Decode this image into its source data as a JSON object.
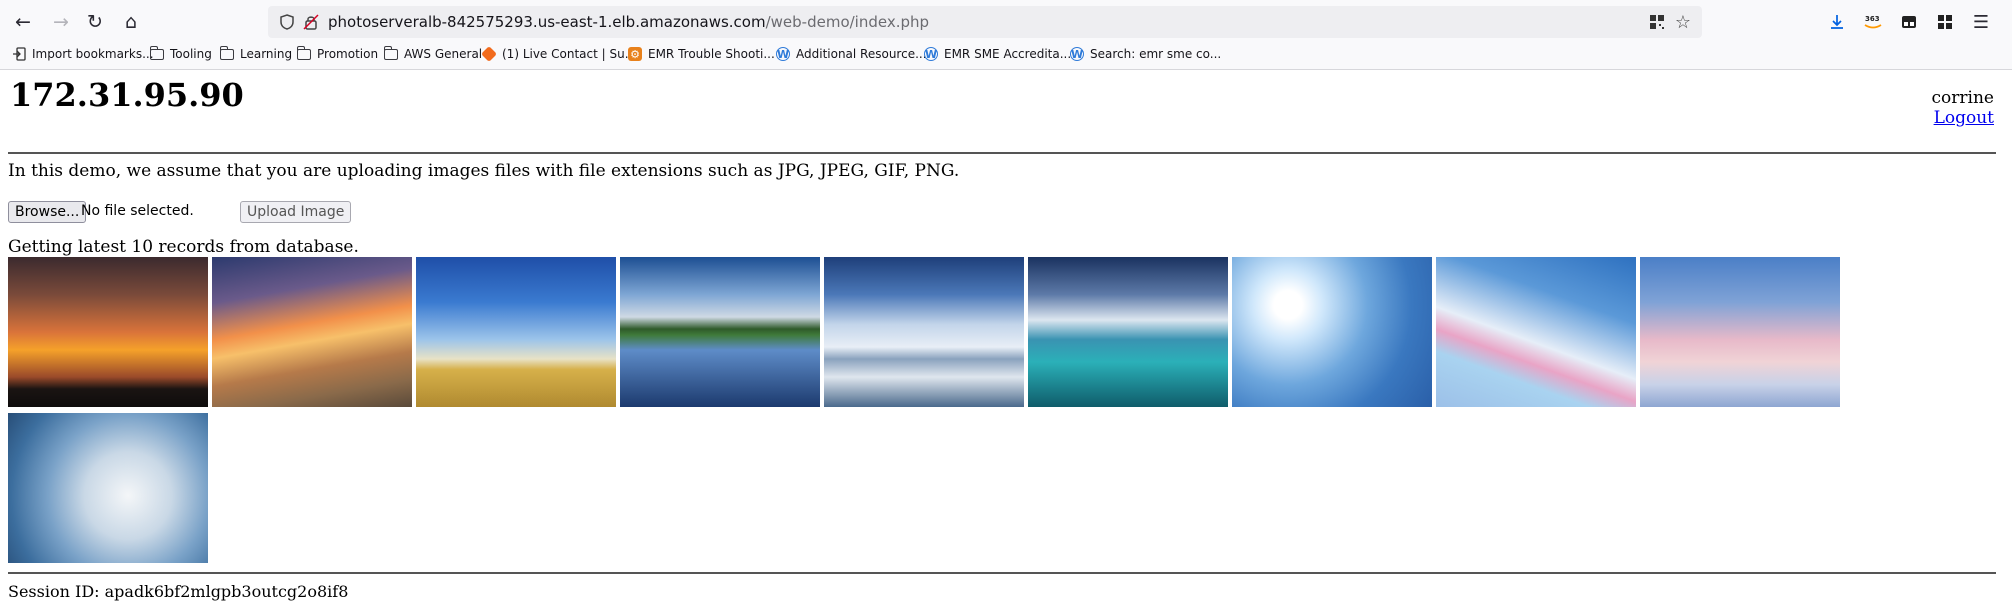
{
  "browser": {
    "url_host": "photoserveralb-842575293.us-east-1.elb.amazonaws.com",
    "url_path": "/web-demo/index.php",
    "icons": [
      "back-icon",
      "forward-icon",
      "reload-icon",
      "home-icon",
      "shield-icon",
      "insecure-lock-icon",
      "qr-code-icon",
      "star-icon",
      "download-icon",
      "amazon-extension-icon",
      "container-icon",
      "extensions-icon",
      "menu-icon"
    ]
  },
  "bookmarks": [
    {
      "label": "Import bookmarks...",
      "icon": "import-icon"
    },
    {
      "label": "Tooling",
      "icon": "folder-icon"
    },
    {
      "label": "Learning",
      "icon": "folder-icon"
    },
    {
      "label": "Promotion",
      "icon": "folder-icon"
    },
    {
      "label": "AWS General",
      "icon": "folder-icon"
    },
    {
      "label": "(1) Live Contact | Su...",
      "icon": "orange-cube-icon"
    },
    {
      "label": "EMR Trouble Shooti...",
      "icon": "emr-icon"
    },
    {
      "label": "Additional Resource...",
      "icon": "wiki-icon"
    },
    {
      "label": "EMR SME Accredita...",
      "icon": "wiki-icon"
    },
    {
      "label": "Search: emr sme co...",
      "icon": "wiki-icon"
    }
  ],
  "page": {
    "host_ip": "172.31.95.90",
    "username": "corrine",
    "logout_label": "Logout",
    "intro": "In this demo, we assume that you are uploading images files with file extensions such as JPG, JPEG, GIF, PNG.",
    "browse_label": "Browse...",
    "no_file_label": "No file selected.",
    "upload_label": "Upload Image",
    "records_label": "Getting latest 10 records from database.",
    "session_label": "Session ID: apadk6bf2mlgpb3outcg2o8if8"
  },
  "images": [
    {
      "name": "sunset-skyline-photo"
    },
    {
      "name": "beach-sunset-photo"
    },
    {
      "name": "road-sky-photo"
    },
    {
      "name": "lake-reflection-photo"
    },
    {
      "name": "pier-clouds-photo"
    },
    {
      "name": "reef-clouds-photo"
    },
    {
      "name": "sun-clouds-photo"
    },
    {
      "name": "rainbow-clouds-photo"
    },
    {
      "name": "soft-clouds-photo"
    },
    {
      "name": "storm-clouds-photo"
    }
  ]
}
